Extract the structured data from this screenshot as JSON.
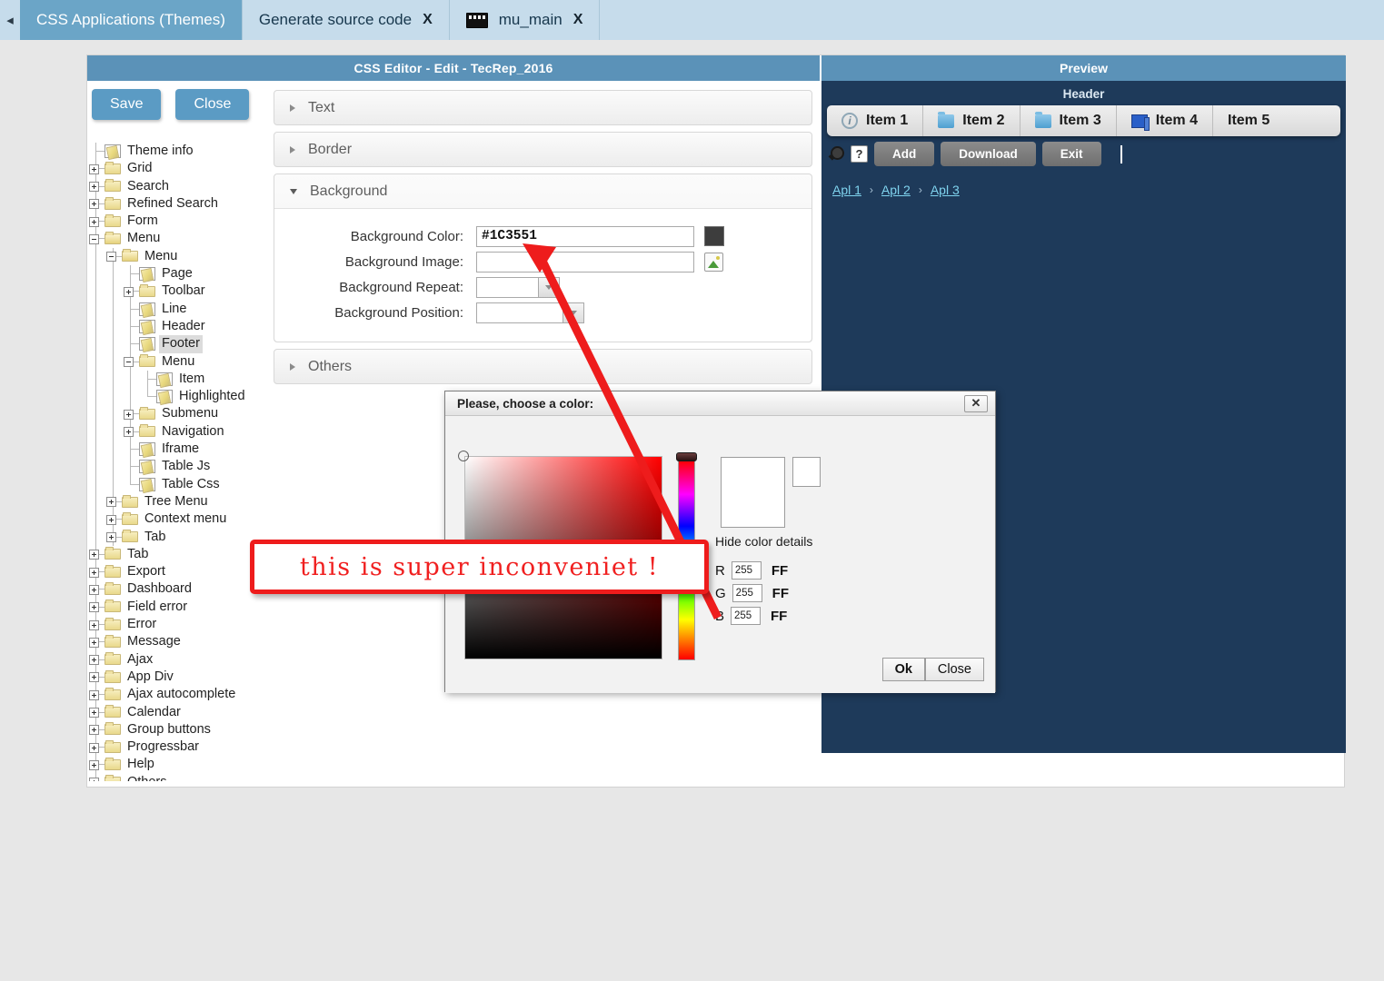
{
  "browser_tabs": {
    "back_icon": "back-arrow-icon",
    "items": [
      {
        "label": "CSS Applications (Themes)",
        "active": true,
        "close": "",
        "icon": ""
      },
      {
        "label": "Generate source code",
        "active": false,
        "close": "X",
        "icon": ""
      },
      {
        "label": "mu_main",
        "active": false,
        "close": "X",
        "icon": "film-strip-icon"
      }
    ]
  },
  "window": {
    "title": "CSS Editor - Edit - TecRep_2016",
    "preview_title": "Preview"
  },
  "toolbar": {
    "save_label": "Save",
    "close_label": "Close"
  },
  "tree": {
    "items": [
      {
        "label": "Theme info",
        "depth": 1,
        "type": "page",
        "toggle": "none",
        "selected": false
      },
      {
        "label": "Grid",
        "depth": 1,
        "type": "folder",
        "toggle": "plus",
        "selected": false
      },
      {
        "label": "Search",
        "depth": 1,
        "type": "folder",
        "toggle": "plus",
        "selected": false
      },
      {
        "label": "Refined Search",
        "depth": 1,
        "type": "folder",
        "toggle": "plus",
        "selected": false
      },
      {
        "label": "Form",
        "depth": 1,
        "type": "folder",
        "toggle": "plus",
        "selected": false
      },
      {
        "label": "Menu",
        "depth": 1,
        "type": "folder-open",
        "toggle": "minus",
        "selected": false
      },
      {
        "label": "Menu",
        "depth": 2,
        "type": "folder-open",
        "toggle": "minus",
        "selected": false
      },
      {
        "label": "Page",
        "depth": 3,
        "type": "page",
        "toggle": "none",
        "selected": false
      },
      {
        "label": "Toolbar",
        "depth": 3,
        "type": "folder",
        "toggle": "plus",
        "selected": false
      },
      {
        "label": "Line",
        "depth": 3,
        "type": "page",
        "toggle": "none",
        "selected": false
      },
      {
        "label": "Header",
        "depth": 3,
        "type": "page",
        "toggle": "none",
        "selected": false
      },
      {
        "label": "Footer",
        "depth": 3,
        "type": "page",
        "toggle": "none",
        "selected": true
      },
      {
        "label": "Menu",
        "depth": 3,
        "type": "folder",
        "toggle": "minus",
        "selected": false
      },
      {
        "label": "Item",
        "depth": 4,
        "type": "page",
        "toggle": "none",
        "selected": false
      },
      {
        "label": "Highlighted",
        "depth": 4,
        "type": "page",
        "toggle": "none",
        "selected": false
      },
      {
        "label": "Submenu",
        "depth": 3,
        "type": "folder",
        "toggle": "plus",
        "selected": false
      },
      {
        "label": "Navigation",
        "depth": 3,
        "type": "folder",
        "toggle": "plus",
        "selected": false
      },
      {
        "label": "Iframe",
        "depth": 3,
        "type": "page",
        "toggle": "none",
        "selected": false
      },
      {
        "label": "Table Js",
        "depth": 3,
        "type": "page",
        "toggle": "none",
        "selected": false
      },
      {
        "label": "Table Css",
        "depth": 3,
        "type": "page",
        "toggle": "none",
        "selected": false
      },
      {
        "label": "Tree Menu",
        "depth": 2,
        "type": "folder",
        "toggle": "plus",
        "selected": false
      },
      {
        "label": "Context menu",
        "depth": 2,
        "type": "folder",
        "toggle": "plus",
        "selected": false
      },
      {
        "label": "Tab",
        "depth": 2,
        "type": "folder",
        "toggle": "plus",
        "selected": false
      },
      {
        "label": "Tab",
        "depth": 1,
        "type": "folder",
        "toggle": "plus",
        "selected": false
      },
      {
        "label": "Export",
        "depth": 1,
        "type": "folder",
        "toggle": "plus",
        "selected": false
      },
      {
        "label": "Dashboard",
        "depth": 1,
        "type": "folder",
        "toggle": "plus",
        "selected": false
      },
      {
        "label": "Field error",
        "depth": 1,
        "type": "folder",
        "toggle": "plus",
        "selected": false
      },
      {
        "label": "Error",
        "depth": 1,
        "type": "folder",
        "toggle": "plus",
        "selected": false
      },
      {
        "label": "Message",
        "depth": 1,
        "type": "folder",
        "toggle": "plus",
        "selected": false
      },
      {
        "label": "Ajax",
        "depth": 1,
        "type": "folder",
        "toggle": "plus",
        "selected": false
      },
      {
        "label": "App Div",
        "depth": 1,
        "type": "folder",
        "toggle": "plus",
        "selected": false
      },
      {
        "label": "Ajax autocomplete",
        "depth": 1,
        "type": "folder",
        "toggle": "plus",
        "selected": false
      },
      {
        "label": "Calendar",
        "depth": 1,
        "type": "folder",
        "toggle": "plus",
        "selected": false
      },
      {
        "label": "Group buttons",
        "depth": 1,
        "type": "folder",
        "toggle": "plus",
        "selected": false
      },
      {
        "label": "Progressbar",
        "depth": 1,
        "type": "folder",
        "toggle": "plus",
        "selected": false
      },
      {
        "label": "Help",
        "depth": 1,
        "type": "folder",
        "toggle": "plus",
        "selected": false
      },
      {
        "label": "Others",
        "depth": 1,
        "type": "folder",
        "toggle": "plus",
        "selected": false
      }
    ]
  },
  "accordions": {
    "text": {
      "label": "Text",
      "expanded": false
    },
    "border": {
      "label": "Border",
      "expanded": false
    },
    "background": {
      "label": "Background",
      "expanded": true,
      "fields": {
        "color_label": "Background Color:",
        "color_value": "#1C3551",
        "color_swatch": "#3d3d3d",
        "image_label": "Background Image:",
        "image_value": "",
        "repeat_label": "Background Repeat:",
        "repeat_value": "",
        "position_label": "Background Position:",
        "position_value": ""
      }
    },
    "others": {
      "label": "Others",
      "expanded": false
    }
  },
  "preview": {
    "header_label": "Header",
    "background_color": "#1e3a5a",
    "menu_items": [
      {
        "label": "Item 1",
        "icon": "info-icon"
      },
      {
        "label": "Item 2",
        "icon": "folder-icon"
      },
      {
        "label": "Item 3",
        "icon": "folder-icon"
      },
      {
        "label": "Item 4",
        "icon": "book-icon"
      },
      {
        "label": "Item 5",
        "icon": ""
      }
    ],
    "toolbar": {
      "search_icon": "magnifier-icon",
      "help_icon": "help-icon",
      "help_glyph": "?",
      "buttons": [
        "Add",
        "Download",
        "Exit"
      ]
    },
    "breadcrumb": {
      "items": [
        "Apl 1",
        "Apl 2",
        "Apl 3"
      ],
      "separator": "›"
    }
  },
  "color_dialog": {
    "title": "Please, choose a color:",
    "close_glyph": "✕",
    "hide_details_label": "Hide color details",
    "channels": [
      {
        "name": "R",
        "value": "255",
        "hex": "FF"
      },
      {
        "name": "G",
        "value": "255",
        "hex": "FF"
      },
      {
        "name": "B",
        "value": "255",
        "hex": "FF"
      }
    ],
    "ok_label": "Ok",
    "close_label": "Close",
    "selected_color": "#FFFFFF"
  },
  "annotation": {
    "text": "this is super inconveniet !",
    "color": "#f02020"
  }
}
